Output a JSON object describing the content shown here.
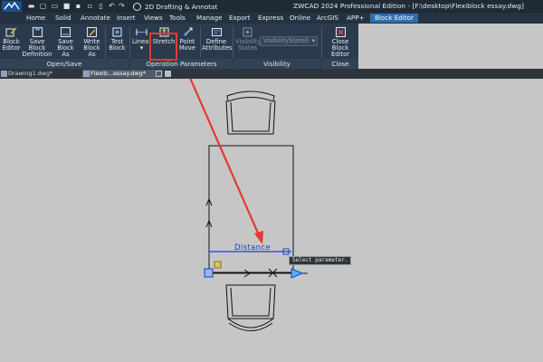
{
  "titlebar": {
    "workspace": "2D Drafting & Annotat",
    "app_title": "ZWCAD 2024 Professional Edition - [F:\\desktop\\Flexiblock essay.dwg]"
  },
  "menu": {
    "items": [
      "Home",
      "Solid",
      "Annotate",
      "Insert",
      "Views",
      "Tools",
      "Manage",
      "Export",
      "Express",
      "Online",
      "ArcGIS",
      "APP+",
      "Block Editor"
    ],
    "active": "Block Editor"
  },
  "ribbon": {
    "buttons": {
      "block_editor": "Block\nEditor",
      "save_block_definition": "Save Block\nDefinition",
      "save_block_as": "Save\nBlock As",
      "write_block_as": "Write\nBlock As",
      "test_block": "Test\nBlock",
      "linear": "Linear",
      "stretch": "Stretch",
      "point_move": "Point\nMove",
      "define_attributes": "Define\nAttributes",
      "visibility_states": "Visibility\nStates",
      "close_block_editor": "Close Block\nEditor"
    },
    "visibility_state_value": "VisibilityState0",
    "groups": {
      "open_save": "Open/Save",
      "operation_parameters": "Operation Parameters",
      "visibility": "Visibility",
      "close": "Close"
    }
  },
  "tabs": {
    "drawing1": "Drawing1.dwg*",
    "flexiblock": "Flexib...essay.dwg*"
  },
  "canvas": {
    "distance_label": "Distance",
    "tooltip": "Select parameter."
  },
  "colors": {
    "accent": "#2d6fb2",
    "highlight": "#e53935",
    "parameter_blue": "#1a3fd0",
    "canvas_bg": "#c6c6c6"
  }
}
